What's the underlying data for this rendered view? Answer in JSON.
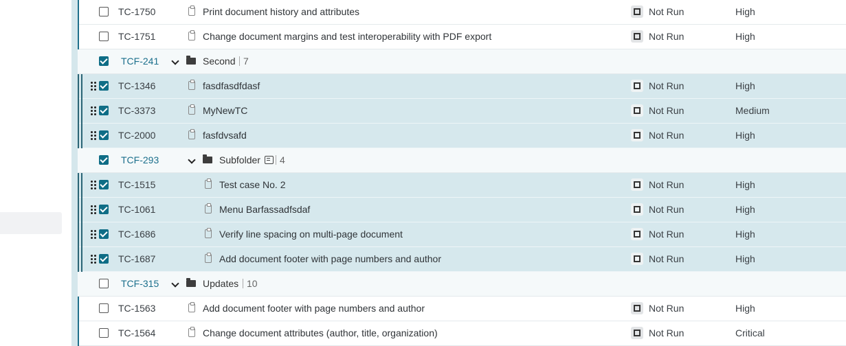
{
  "status_icon": "not-run-status-icon",
  "rows": [
    {
      "kind": "case",
      "id": "TC-1750",
      "title": "Print document history and attributes",
      "status": "Not Run",
      "priority": "High",
      "checked": false,
      "selected": false,
      "indent": 0
    },
    {
      "kind": "case",
      "id": "TC-1751",
      "title": "Change document margins and test interoperability with PDF export",
      "status": "Not Run",
      "priority": "High",
      "checked": false,
      "selected": false,
      "indent": 0
    },
    {
      "kind": "folder",
      "id": "TCF-241",
      "name": "Second",
      "count": "7",
      "checked": true,
      "indent": 0,
      "note": false
    },
    {
      "kind": "case",
      "id": "TC-1346",
      "title": "fasdfasdfdasf",
      "status": "Not Run",
      "priority": "High",
      "checked": true,
      "selected": true,
      "indent": 0
    },
    {
      "kind": "case",
      "id": "TC-3373",
      "title": "MyNewTC",
      "status": "Not Run",
      "priority": "Medium",
      "checked": true,
      "selected": true,
      "indent": 0
    },
    {
      "kind": "case",
      "id": "TC-2000",
      "title": "fasfdvsafd",
      "status": "Not Run",
      "priority": "High",
      "checked": true,
      "selected": true,
      "indent": 0
    },
    {
      "kind": "folder",
      "id": "TCF-293",
      "name": "Subfolder",
      "count": "4",
      "checked": true,
      "indent": 1,
      "note": true
    },
    {
      "kind": "case",
      "id": "TC-1515",
      "title": "Test case No. 2",
      "status": "Not Run",
      "priority": "High",
      "checked": true,
      "selected": true,
      "indent": 1
    },
    {
      "kind": "case",
      "id": "TC-1061",
      "title": "Menu Barfassadfsdaf",
      "status": "Not Run",
      "priority": "High",
      "checked": true,
      "selected": true,
      "indent": 1
    },
    {
      "kind": "case",
      "id": "TC-1686",
      "title": "Verify line spacing on multi-page document",
      "status": "Not Run",
      "priority": "High",
      "checked": true,
      "selected": true,
      "indent": 1
    },
    {
      "kind": "case",
      "id": "TC-1687",
      "title": "Add document footer with page numbers and author",
      "status": "Not Run",
      "priority": "High",
      "checked": true,
      "selected": true,
      "indent": 1
    },
    {
      "kind": "folder",
      "id": "TCF-315",
      "name": "Updates",
      "count": "10",
      "checked": false,
      "indent": 0,
      "note": false
    },
    {
      "kind": "case",
      "id": "TC-1563",
      "title": "Add document footer with page numbers and author",
      "status": "Not Run",
      "priority": "High",
      "checked": false,
      "selected": false,
      "indent": 0
    },
    {
      "kind": "case",
      "id": "TC-1564",
      "title": "Change document attributes (author, title, organization)",
      "status": "Not Run",
      "priority": "Critical",
      "checked": false,
      "selected": false,
      "indent": 0
    }
  ]
}
